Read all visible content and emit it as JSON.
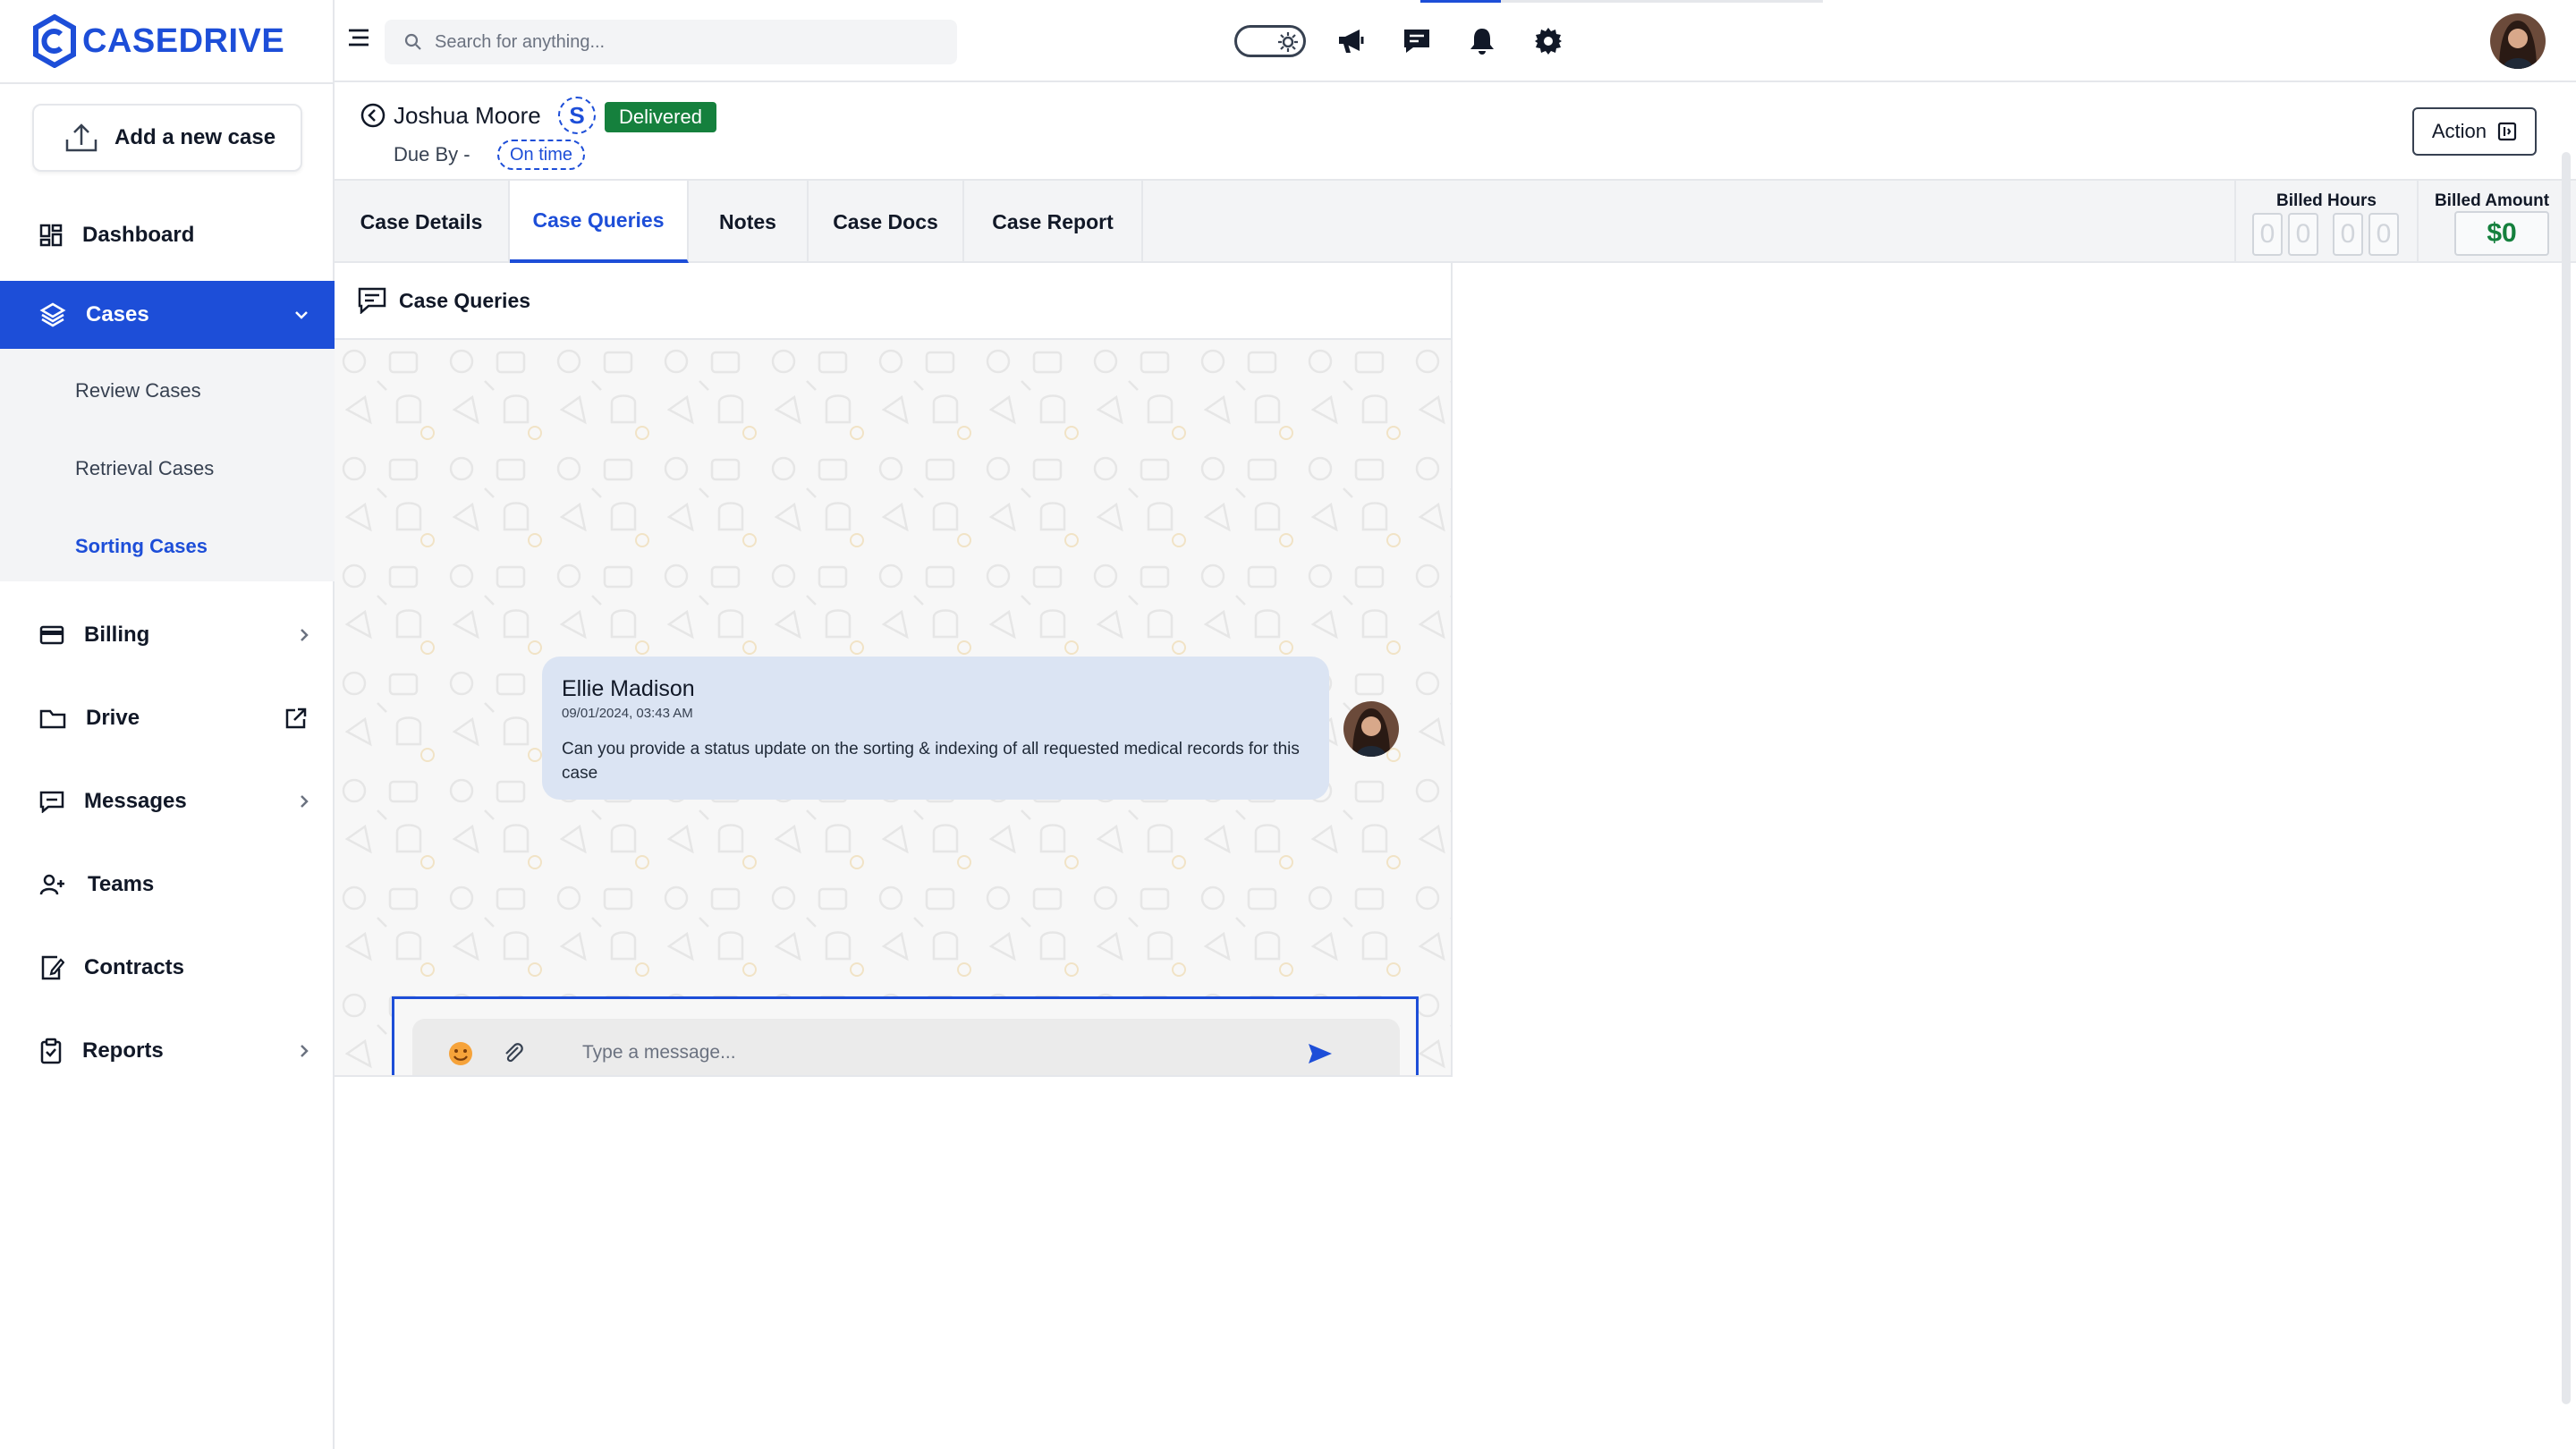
{
  "brand": {
    "name": "CASEDRIVE"
  },
  "sidebar": {
    "add_case_label": "Add a new case",
    "items": [
      {
        "label": "Dashboard"
      },
      {
        "label": "Cases"
      },
      {
        "label": "Billing"
      },
      {
        "label": "Drive"
      },
      {
        "label": "Messages"
      },
      {
        "label": "Teams"
      },
      {
        "label": "Contracts"
      },
      {
        "label": "Reports"
      }
    ],
    "cases_submenu": [
      {
        "label": "Review Cases"
      },
      {
        "label": "Retrieval Cases"
      },
      {
        "label": "Sorting Cases"
      }
    ]
  },
  "topbar": {
    "search_placeholder": "Search for anything..."
  },
  "case": {
    "name": "Joshua Moore",
    "service_badge": "S",
    "status": "Delivered",
    "due_label": "Due By -",
    "due_status": "On time",
    "action_label": "Action"
  },
  "tabs": [
    {
      "label": "Case Details"
    },
    {
      "label": "Case Queries"
    },
    {
      "label": "Notes"
    },
    {
      "label": "Case Docs"
    },
    {
      "label": "Case Report"
    }
  ],
  "billing": {
    "hours_label": "Billed Hours",
    "hours_digits": [
      "0",
      "0",
      "0",
      "0"
    ],
    "amount_label": "Billed Amount",
    "amount_value": "$0"
  },
  "queries": {
    "title": "Case Queries",
    "messages": [
      {
        "author": "Ellie Madison",
        "timestamp": "09/01/2024, 03:43 AM",
        "text": "Can you provide a status update on the sorting & indexing of all requested medical records for this case"
      }
    ],
    "composer_placeholder": "Type a message..."
  },
  "colors": {
    "accent": "#1d4ed8",
    "success": "#15803d",
    "bubble": "#dbe4f3"
  }
}
